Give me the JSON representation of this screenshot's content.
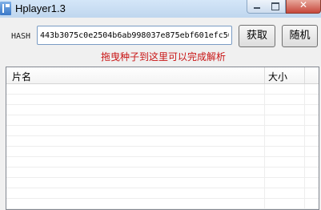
{
  "window": {
    "title": "Hplayer1.3",
    "close_glyph": "✕"
  },
  "hash": {
    "label": "HASH",
    "value": "443b3075c0e2504b6ab998037e875ebf601efc50"
  },
  "buttons": {
    "fetch_label": "获取",
    "random_label": "随机"
  },
  "hint": "拖曳种子到这里可以完成解析",
  "list": {
    "columns": [
      "片名",
      "大小"
    ],
    "rows": []
  },
  "colors": {
    "hint": "#c81414",
    "titlebar": "#bfd6ee"
  }
}
